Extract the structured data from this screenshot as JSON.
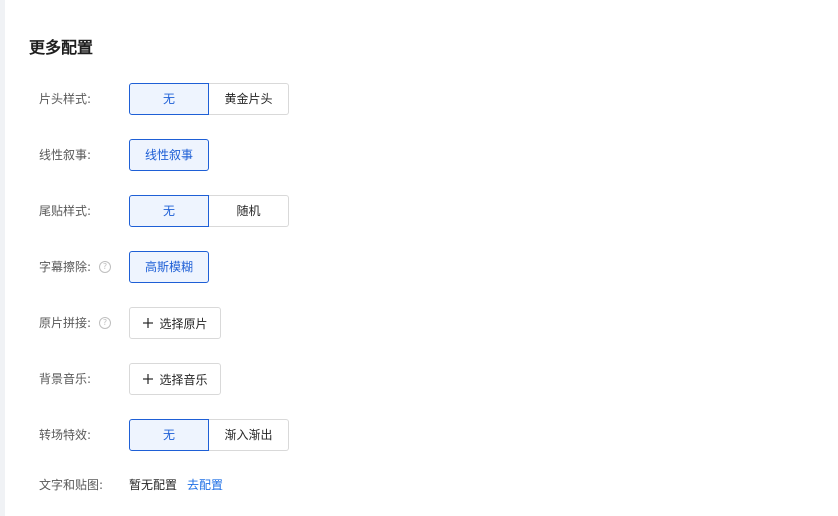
{
  "section": {
    "title": "更多配置"
  },
  "rows": {
    "intro": {
      "label": "片头样式:",
      "options": [
        "无",
        "黄金片头"
      ],
      "selected": "无"
    },
    "narrative": {
      "label": "线性叙事:",
      "options": [
        "线性叙事"
      ],
      "selected": "线性叙事"
    },
    "outro": {
      "label": "尾贴样式:",
      "options": [
        "无",
        "随机"
      ],
      "selected": "无"
    },
    "subtitle_erase": {
      "label": "字幕擦除:",
      "help_icon": "question-circle-icon",
      "options": [
        "高斯模糊"
      ],
      "selected": "高斯模糊"
    },
    "source_splice": {
      "label": "原片拼接:",
      "help_icon": "question-circle-icon",
      "button_icon": "plus-icon",
      "button_label": "选择原片"
    },
    "bgm": {
      "label": "背景音乐:",
      "button_icon": "plus-icon",
      "button_label": "选择音乐"
    },
    "transition": {
      "label": "转场特效:",
      "options": [
        "无",
        "渐入渐出"
      ],
      "selected": "无"
    },
    "text_sticker": {
      "label": "文字和贴图:",
      "value": "暂无配置",
      "link": "去配置"
    }
  },
  "colors": {
    "accent": "#1e5fd6",
    "accent_bg": "#eef4fe",
    "link": "#1e6fe6",
    "border": "#d9d9d9"
  }
}
